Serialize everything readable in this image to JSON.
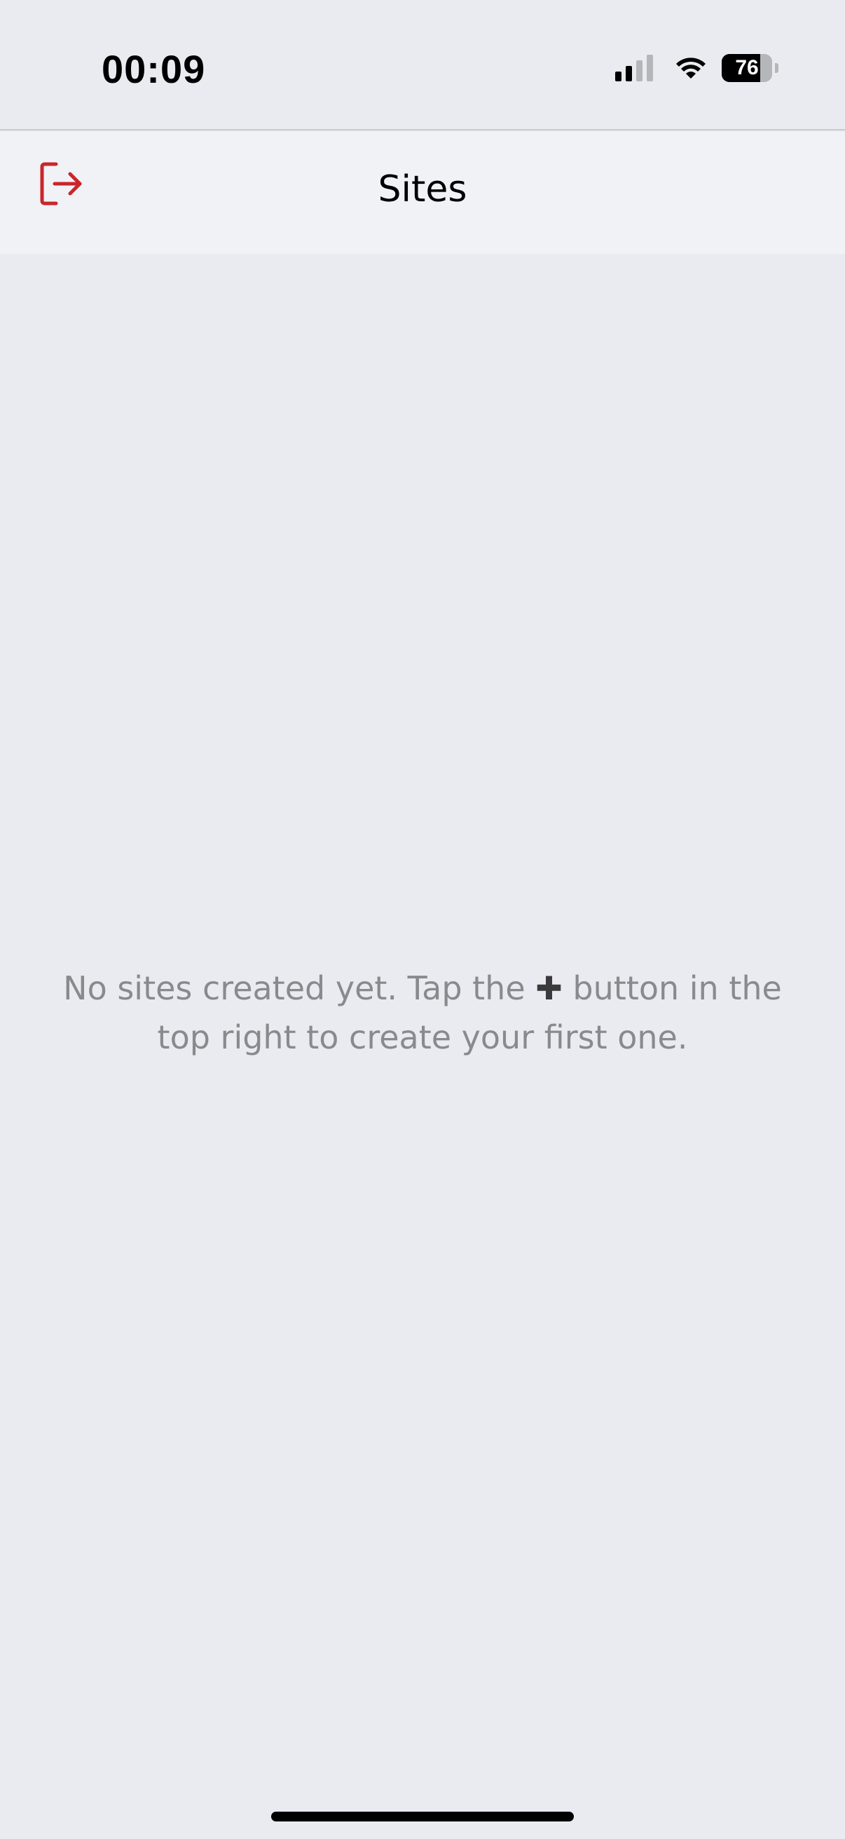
{
  "status_bar": {
    "time": "00:09",
    "battery_level": 76,
    "battery_text": "76",
    "signal_bars_active": 2,
    "signal_bars_total": 4,
    "icons": [
      "cellular-signal-icon",
      "wifi-icon",
      "battery-icon"
    ]
  },
  "nav": {
    "title": "Sites",
    "left_icon": "logout-icon"
  },
  "empty_state": {
    "text_before_icon": "No sites created yet. Tap the ",
    "icon_glyph": "✚",
    "icon_name": "plus-icon",
    "text_after_icon": " button in the top right to create your first one."
  },
  "colors": {
    "background": "#EAEBF0",
    "nav_background": "#F1F2F6",
    "logout_icon": "#C8262B",
    "empty_text": "#8A8A8E",
    "plus_icon": "#3A3A3C"
  }
}
